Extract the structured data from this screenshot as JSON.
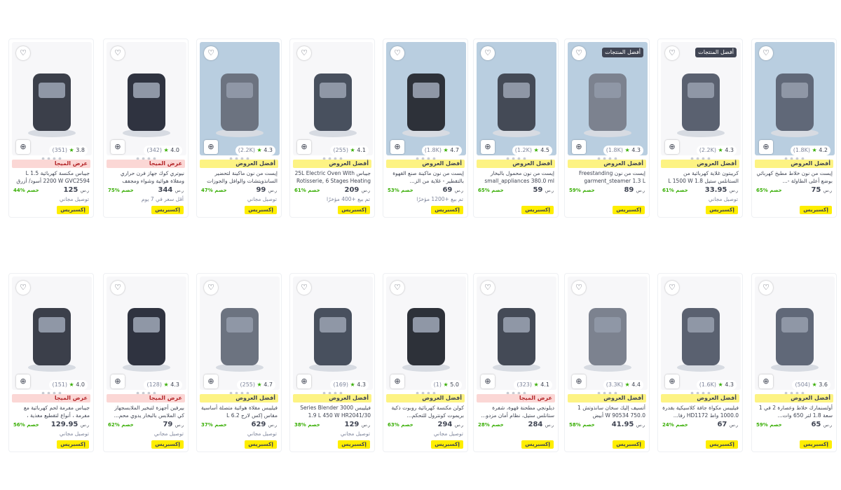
{
  "labels": {
    "wishlist_icon": "♡",
    "cart_icon": "⊕",
    "star": "★",
    "currency": "ر.س",
    "express": "إكسبريس",
    "mega_deal": "عرض الميجا",
    "best_offers": "أفضل العروض",
    "best_products": "أفضل المنتجات",
    "free_delivery": "توصيل مجاني",
    "truck_icon": "🚚"
  },
  "row1": [
    {
      "title": "جيباس مكنسة كهربائية 1.5 L 2200 W GVC2594 أسود/ أزرق",
      "price": "125",
      "old": "",
      "discount": "44% خصم",
      "rating": "3.8",
      "count": "(351)",
      "badge": "عرض الميجا",
      "badge_type": "mega",
      "delivery": "توصيل مجاني",
      "top_tag": "",
      "blue": false
    },
    {
      "title": "نيوتري كوك جهاز فرن حراري ومقلاة هوائية وشواء ومجفف",
      "price": "344",
      "old": "",
      "discount": "75% خصم",
      "rating": "4.0",
      "count": "(342)",
      "badge": "عرض الميجا",
      "badge_type": "mega",
      "delivery": "أقل سعر في 7 يوم",
      "top_tag": "",
      "blue": false
    },
    {
      "title": "إيست من نون ماكينة لتحضير السانذويتشات والوافل والجوزات",
      "price": "99",
      "old": "",
      "discount": "47% خصم",
      "rating": "4.3",
      "count": "(2.2K)",
      "badge": "أفضل العروض",
      "badge_type": "best",
      "delivery": "توصيل مجاني",
      "top_tag": "",
      "blue": true
    },
    {
      "title": "جيباس 25L Electric Oven With Rotisserie, 6 Stages Heating S",
      "price": "209",
      "old": "",
      "discount": "61% خصم",
      "rating": "4.1",
      "count": "(255)",
      "badge": "أفضل العروض",
      "badge_type": "best",
      "delivery": "تم بيع +400 مؤخرًا",
      "top_tag": "",
      "blue": false
    },
    {
      "title": "إيست من نون ماكينة صنع القهوة بالتقطير - غلاية من الز...",
      "price": "69",
      "old": "",
      "discount": "53% خصم",
      "rating": "4.7",
      "count": "(1.8K)",
      "badge": "أفضل العروض",
      "badge_type": "best",
      "delivery": "تم بيع +1200 مؤخرًا",
      "top_tag": "",
      "blue": true
    },
    {
      "title": "إيست من نون محمول بالبخار small_appliances 380.0 ml جه...",
      "price": "59",
      "old": "",
      "discount": "65% خصم",
      "rating": "4.5",
      "count": "(1.2K)",
      "badge": "أفضل العروض",
      "badge_type": "best",
      "delivery": "",
      "top_tag": "",
      "blue": true
    },
    {
      "title": "إيست من نون Freestanding garment_steamer 1.3 L Freest...",
      "price": "89",
      "old": "",
      "discount": "59% خصم",
      "rating": "4.3",
      "count": "(1.8K)",
      "badge": "أفضل العروض",
      "badge_type": "best",
      "delivery": "",
      "top_tag": "أفضل المنتجات",
      "blue": true
    },
    {
      "title": "كريبتون غلاية كهربائية من الستانلس ستيل 1.8 L 1500 W",
      "price": "33.95",
      "old": "",
      "discount": "61% خصم",
      "rating": "4.3",
      "count": "(2.2K)",
      "badge": "أفضل العروض",
      "badge_type": "best",
      "delivery": "توصيل مجاني",
      "top_tag": "أفضل المنتجات",
      "blue": false
    },
    {
      "title": "إيست من نون خلاط مطبخ كهربائي بوضع أعلى الطاولة -...",
      "price": "75",
      "old": "",
      "discount": "65% خصم",
      "rating": "4.2",
      "count": "(1.8K)",
      "badge": "أفضل العروض",
      "badge_type": "best",
      "delivery": "",
      "top_tag": "",
      "blue": true
    }
  ],
  "row2": [
    {
      "title": "جيباس مفرمة لحم كهربائية مع مفرمة ، أنواع لتقطيع مغذية ،",
      "price": "129.95",
      "old": "",
      "discount": "56% خصم",
      "rating": "4.0",
      "count": "(151)",
      "badge": "عرض الميجا",
      "badge_type": "mega",
      "delivery": "توصيل مجاني",
      "top_tag": "",
      "blue": false
    },
    {
      "title": "بيرفين أجهزة لتبخير الملابسجهاز كي الملابس بالبخار يدوي محم...",
      "price": "79",
      "old": "",
      "discount": "62% خصم",
      "rating": "4.3",
      "count": "(128)",
      "badge": "عرض الميجا",
      "badge_type": "mega",
      "delivery": "توصيل مجاني",
      "top_tag": "",
      "blue": false
    },
    {
      "title": "فيليبس مقلاة هوائية متصلة أساسية مقاس إكس لارج 6.2 L",
      "price": "629",
      "old": "",
      "discount": "37% خصم",
      "rating": "4.7",
      "count": "(255)",
      "badge": "أفضل العروض",
      "badge_type": "best",
      "delivery": "توصيل مجاني",
      "top_tag": "",
      "blue": false
    },
    {
      "title": "فيليبس Series Blender 3000 1.9 L 450 W HR2041/30 White",
      "price": "129",
      "old": "",
      "discount": "38% خصم",
      "rating": "4.3",
      "count": "(169)",
      "badge": "أفضل العروض",
      "badge_type": "best",
      "delivery": "توصيل مجاني",
      "top_tag": "",
      "blue": false
    },
    {
      "title": "كولن مكنسة كهربائية روبوت ذكية بريموت كونترول للتحكم...",
      "price": "294",
      "old": "",
      "discount": "63% خصم",
      "rating": "5.0",
      "count": "(1)",
      "badge": "أفضل العروض",
      "badge_type": "best",
      "delivery": "توصيل مجاني",
      "top_tag": "",
      "blue": false
    },
    {
      "title": "ديلونجي مطحنة قهوة، شفرة ستانلس ستيل، نظام أمان مزدو...",
      "price": "284",
      "old": "",
      "discount": "28% خصم",
      "rating": "4.1",
      "count": "(323)",
      "badge": "عرض الميجا",
      "badge_type": "mega",
      "delivery": "",
      "top_tag": "",
      "blue": false
    },
    {
      "title": "أتسيف إليك سخان سانذوتش 1 750.0 W 90534 أبيض",
      "price": "41.95",
      "old": "",
      "discount": "58% خصم",
      "rating": "4.4",
      "count": "(3.3K)",
      "badge": "أفضل العروض",
      "badge_type": "best",
      "delivery": "",
      "top_tag": "",
      "blue": false
    },
    {
      "title": "فيليبس مكواة جافة كلاسيكية بقدرة 1000.0 واط HD1172 رفا...",
      "price": "67",
      "old": "",
      "discount": "24% خصم",
      "rating": "4.3",
      "count": "(1.6K)",
      "badge": "أفضل العروض",
      "badge_type": "best",
      "delivery": "",
      "top_tag": "",
      "blue": false
    },
    {
      "title": "أولسنمارك خلاط وعصارة 2 في 1 سعة 1.8 لتر 650 وات...",
      "price": "65",
      "old": "",
      "discount": "59% خصم",
      "rating": "3.6",
      "count": "(504)",
      "badge": "أفضل العروض",
      "badge_type": "best",
      "delivery": "",
      "top_tag": "",
      "blue": false
    }
  ]
}
